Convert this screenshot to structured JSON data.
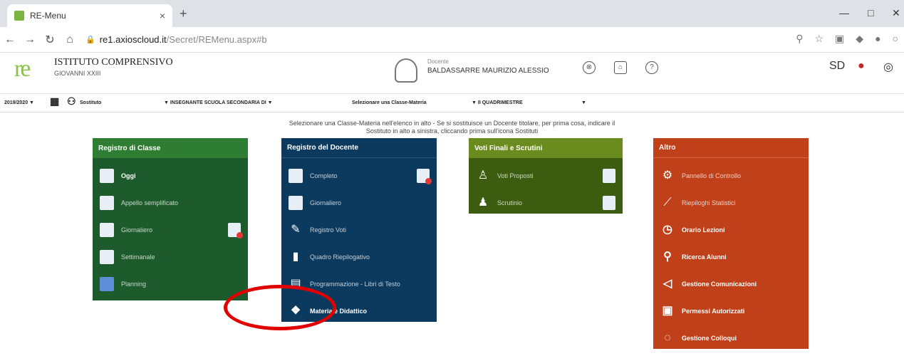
{
  "browser": {
    "tab_title": "RE-Menu",
    "url_host": "re1.axioscloud.it",
    "url_path": "/Secret/REMenu.aspx#b"
  },
  "header": {
    "logo": "re",
    "school_name": "ISTITUTO COMPRENSIVO",
    "school_sub": "GIOVANNI XXIII",
    "user_role": "Docente",
    "user_name": "BALDASSARRE MAURIZIO ALESSIO",
    "right_logo_text": "SD"
  },
  "toolbar": {
    "year": "2019/2020 ▼",
    "substitute": "Sostituto",
    "class_select": "▼  INSEGNANTE SCUOLA SECONDARIA DI ▼",
    "class_materia": "Selezionare una Classe-Materia",
    "period": "▼  II QUADRIMESTRE",
    "period_arrow": "▼"
  },
  "message": {
    "line1": "Selezionare una Classe-Materia nell'elenco in alto - Se si sostituisce un Docente titolare, per prima cosa, indicare il",
    "line2": "Sostituto in alto a sinistra, cliccando prima sull'icona Sostituti"
  },
  "panels": [
    {
      "title": "Registro di Classe",
      "items": [
        "Oggi",
        "Appello semplificato",
        "Giornaliero",
        "Settimanale",
        "Planning"
      ]
    },
    {
      "title": "Registro del Docente",
      "items": [
        "Completo",
        "Giornaliero",
        "Registro Voti",
        "Quadro Riepilogativo",
        "Programmazione - Libri di Testo",
        "Materiale Didattico"
      ]
    },
    {
      "title": "Voti Finali e Scrutini",
      "items": [
        "Voti Proposti",
        "Scrutinio"
      ]
    },
    {
      "title": "Altro",
      "items": [
        "Pannello di Controllo",
        "Riepiloghi Statistici",
        "Orario Lezioni",
        "Ricerca Alunni",
        "Gestione Comunicazioni",
        "Permessi Autorizzati",
        "Gestione Colloqui"
      ]
    }
  ],
  "colors": {
    "green_dark": "#1e5b2c",
    "green_header": "#2e7d32",
    "blue_dark": "#0c3a5e",
    "olive": "#3c5d0f",
    "olive_header": "#6a8c1f",
    "orange_red": "#c0401a",
    "annotation": "#e00000"
  }
}
